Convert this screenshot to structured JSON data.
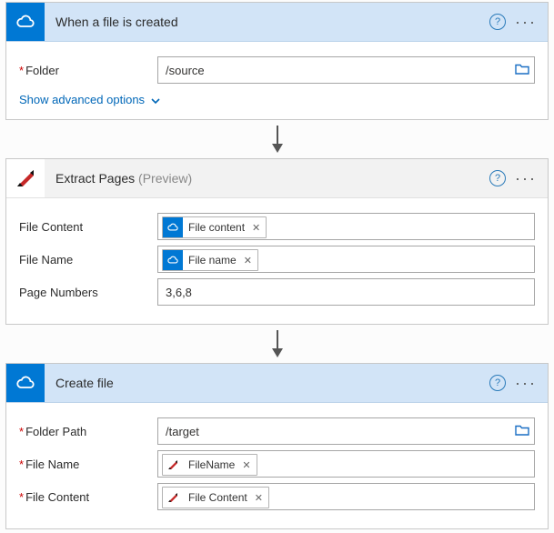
{
  "colors": {
    "onedrive_blue": "#0078d4",
    "header_blue": "#d2e4f7",
    "header_gray": "#f2f2f2",
    "link_blue": "#0067b8",
    "required_red": "#c00"
  },
  "step1": {
    "title": "When a file is created",
    "fields": {
      "folder_label": "Folder",
      "folder_value": "/source"
    },
    "advanced_link": "Show advanced options"
  },
  "step2": {
    "title": "Extract Pages",
    "title_suffix": " (Preview)",
    "fields": {
      "file_content_label": "File Content",
      "file_content_token": "File content",
      "file_name_label": "File Name",
      "file_name_token": "File name",
      "page_numbers_label": "Page Numbers",
      "page_numbers_value": "3,6,8"
    }
  },
  "step3": {
    "title": "Create file",
    "fields": {
      "folder_path_label": "Folder Path",
      "folder_path_value": "/target",
      "file_name_label": "File Name",
      "file_name_token": "FileName",
      "file_content_label": "File Content",
      "file_content_token": "File Content"
    }
  }
}
